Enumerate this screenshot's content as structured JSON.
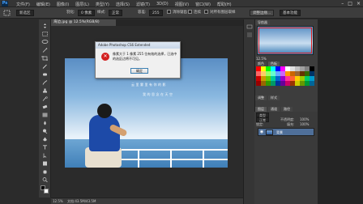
{
  "app": {
    "logo": "Ps"
  },
  "menubar": {
    "items": [
      "文件(F)",
      "编辑(E)",
      "图像(I)",
      "图层(L)",
      "类型(Y)",
      "选择(S)",
      "滤镜(T)",
      "3D(D)",
      "视图(V)",
      "窗口(W)",
      "帮助(H)"
    ],
    "window_controls": [
      "–",
      "□",
      "×"
    ]
  },
  "options": {
    "mode_label": "新选区",
    "feather_label": "羽化:",
    "feather_value": "0 像素",
    "style_label": "样式:",
    "style_value": "正常",
    "tolerance_label": "容差:",
    "tolerance_value": "255",
    "antialias_label": "消除锯齿",
    "contiguous_label": "连续",
    "sample_all_label": "对所有图层取样",
    "refine_label": "调整边缘...",
    "workspace_label": "基本功能"
  },
  "document": {
    "tab_label": "海边.jpg @ 12.5%(RGB/8)",
    "poem_line1": "云里雾里有你的影",
    "poem_line2": "我的思念在天空"
  },
  "status": {
    "zoom": "12.5%",
    "doc_size": "文档:43.5M/43.5M"
  },
  "dialog": {
    "title": "Adobe Photoshop CS6 Extended",
    "message": "像素大于 1 像素 255 位有效的选择，已选中的选区边将不可见。",
    "ok_label": "确定"
  },
  "navigator": {
    "zoom": "12.5%"
  },
  "panels": {
    "nav_tab": "导航器",
    "color_tab": "颜色",
    "swatch_tab": "色板",
    "adjust_tab": "调整",
    "style_tab": "样式",
    "layers_tab": "图层",
    "channels_tab": "通道",
    "paths_tab": "路径",
    "kind_label": "类型",
    "blend_mode": "正常",
    "opacity_label": "不透明度:",
    "opacity_value": "100%",
    "lock_label": "锁定:",
    "fill_label": "填充:",
    "fill_value": "100%",
    "layer_name": "背景"
  },
  "swatch_colors": [
    "#ff0000",
    "#ffff00",
    "#00ff00",
    "#00ffff",
    "#0000ff",
    "#ff00ff",
    "#ffffff",
    "#e0e0e0",
    "#c0c0c0",
    "#a0a0a0",
    "#808080",
    "#000000",
    "#ff6666",
    "#ffcc66",
    "#99ff66",
    "#66ffcc",
    "#66aaff",
    "#cc66ff",
    "#ff9900",
    "#cc6600",
    "#996633",
    "#663300",
    "#336600",
    "#003366",
    "#cc0000",
    "#cc9900",
    "#66cc00",
    "#00cc99",
    "#0066cc",
    "#9900cc",
    "#ff3399",
    "#ff6633",
    "#ffcc00",
    "#99cc00",
    "#00cc66",
    "#0099cc",
    "#990000",
    "#996600",
    "#339900",
    "#009966",
    "#003399",
    "#660099",
    "#cc0066",
    "#993300",
    "#cccc00",
    "#669900",
    "#009933",
    "#006699"
  ],
  "colors": {
    "error_red": "#d32020",
    "layer_selected": "#4f6f99",
    "nav_frame": "#e02020",
    "fg_color": "#000000",
    "bg_color": "#ffffff"
  }
}
